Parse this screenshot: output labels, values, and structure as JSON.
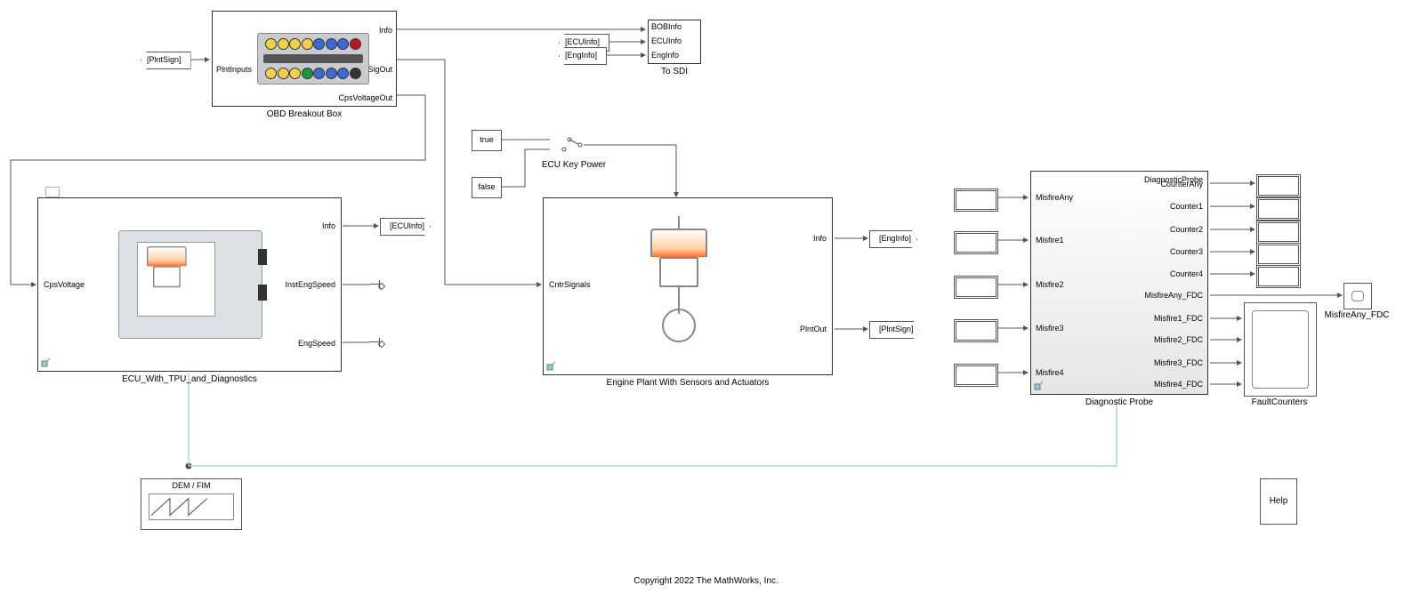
{
  "obd": {
    "title": "OBD Breakout Box",
    "in": "PlntInputs",
    "out1": "Info",
    "out2": "CntrSigOut",
    "out3": "CpsVoltageOut"
  },
  "tags": {
    "plntSign_in": "[PlntSign]",
    "ecuInfo_goto": "[ECUInfo]",
    "ecuInfo_from": "[ECUInfo]",
    "engInfo_from": "[EngInfo]",
    "engInfo_goto": "[EngInfo]",
    "plntSign_goto": "[PlntSign]"
  },
  "toSDI": {
    "p1": "BOBInfo",
    "p2": "ECUInfo",
    "p3": "EngInfo",
    "title": "To SDI"
  },
  "consts": {
    "t": "true",
    "f": "false"
  },
  "switch": {
    "title": "ECU Key Power"
  },
  "ecu": {
    "title": "ECU_With_TPU_and_Diagnostics",
    "in": "CpsVoltage",
    "o1": "Info",
    "o2": "InstEngSpeed",
    "o3": "EngSpeed"
  },
  "plant": {
    "title": "Engine Plant With Sensors and Actuators",
    "in": "CntrSignals",
    "o1": "Info",
    "o2": "PlntOut"
  },
  "probe": {
    "title": "Diagnostic Probe",
    "header": "DiagnosticProbe",
    "inL": [
      "MisfireAny",
      "Misfire1",
      "Misfire2",
      "Misfire3",
      "Misfire4"
    ],
    "outR": [
      "CounterAny",
      "Counter1",
      "Counter2",
      "Counter3",
      "Counter4",
      "MisfireAny_FDC",
      "Misfire1_FDC",
      "Misfire2_FDC",
      "Misfire3_FDC",
      "Misfire4_FDC"
    ]
  },
  "fdc": {
    "title": "MisfireAny_FDC"
  },
  "faultCounters": "FaultCounters",
  "demfim": "DEM / FIM",
  "help": "Help",
  "copyright": "Copyright 2022 The MathWorks, Inc."
}
